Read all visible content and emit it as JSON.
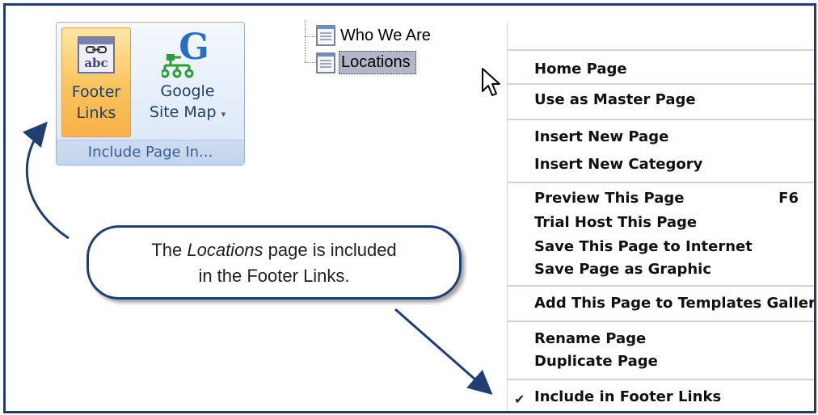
{
  "ribbon": {
    "footer_links": {
      "line1": "Footer",
      "line2": "Links",
      "icon_text": "abc"
    },
    "google_site_map": {
      "line1": "Google",
      "line2": "Site Map",
      "icon_letter": "G",
      "caret": "▾"
    },
    "group_caption": "Include Page In..."
  },
  "tree": {
    "items": [
      {
        "label": "Who We Are"
      },
      {
        "label": "Locations"
      }
    ]
  },
  "context_menu": {
    "items": [
      {
        "label": "Home Page"
      },
      {
        "label": "Use as Master Page"
      },
      {
        "label": "Insert New Page"
      },
      {
        "label": "Insert New Category"
      },
      {
        "label": "Preview This Page",
        "shortcut": "F6"
      },
      {
        "label": "Trial Host This Page"
      },
      {
        "label": "Save This Page to Internet"
      },
      {
        "label": "Save Page as Graphic"
      },
      {
        "label": "Add This Page to Templates Gallery"
      },
      {
        "label": "Rename Page"
      },
      {
        "label": "Duplicate Page"
      },
      {
        "label": "Include in Footer Links",
        "checked": true,
        "check_mark": "✔"
      }
    ]
  },
  "callout": {
    "prefix": "The ",
    "emphasis": "Locations",
    "suffix": " page is included",
    "line2": "in the Footer Links."
  },
  "colors": {
    "frame_border": "#1f3f73",
    "ribbon_active": "#fbc35b",
    "selection": "#b0b7c6"
  }
}
